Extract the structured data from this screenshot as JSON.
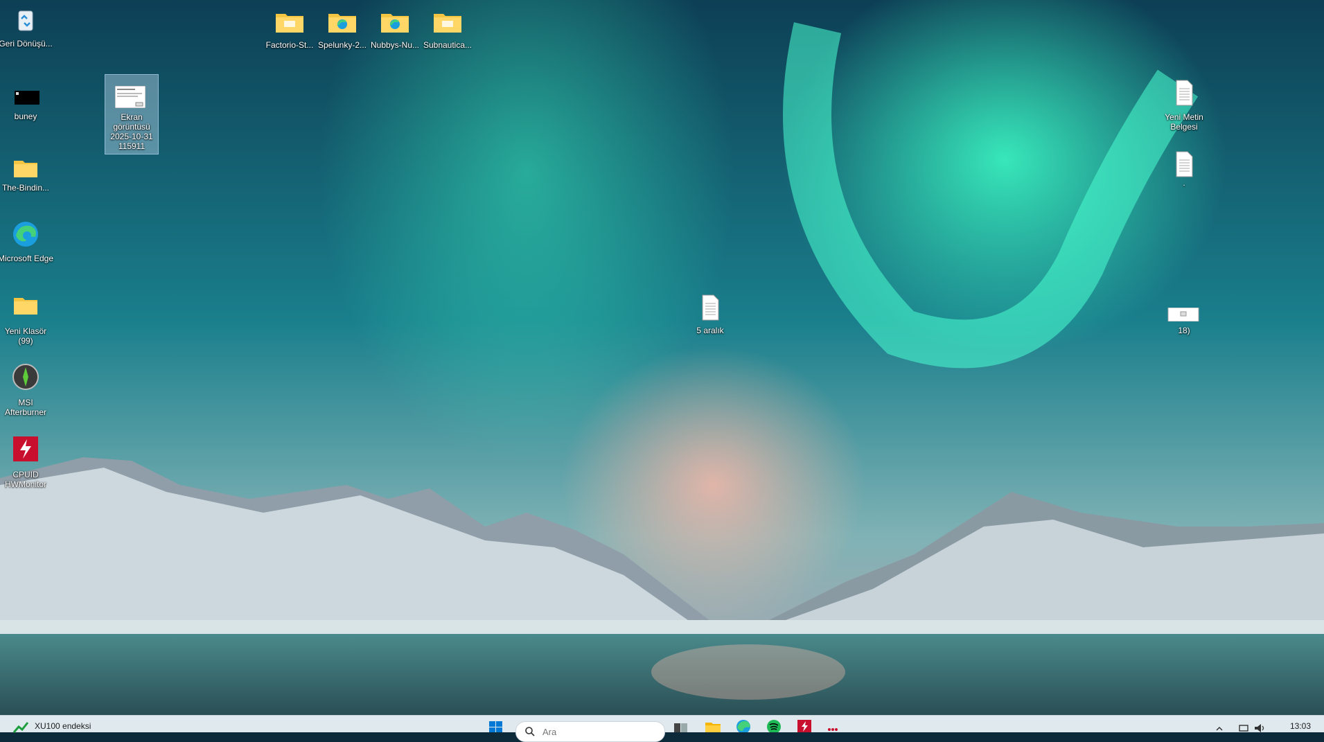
{
  "desktop": {
    "left_column": [
      {
        "label": "Geri Dönüşü...",
        "icon": "recycle-bin-icon"
      },
      {
        "label": "buney",
        "icon": "shortcut-black-icon"
      },
      {
        "label": "The-Bindin...",
        "icon": "folder-icon"
      },
      {
        "label": "Microsoft Edge",
        "icon": "edge-icon"
      },
      {
        "label": "Yeni Klasör (99)",
        "icon": "folder-icon"
      },
      {
        "label": "MSI Afterburner",
        "icon": "msi-afterburner-icon"
      },
      {
        "label": "CPUID HWMonitor",
        "icon": "hwmonitor-icon"
      }
    ],
    "top_row": [
      {
        "label": "Factorio-St...",
        "icon": "folder-icon"
      },
      {
        "label": "Spelunky-2...",
        "icon": "folder-edge-icon"
      },
      {
        "label": "Nubbys-Nu...",
        "icon": "folder-edge-icon"
      },
      {
        "label": "Subnautica...",
        "icon": "folder-icon"
      }
    ],
    "screenshot_file": {
      "label": "Ekran görüntüsü 2025-10-31 115911",
      "icon": "image-file-icon"
    },
    "text_doc_center": {
      "label": "5 aralık",
      "icon": "text-document-icon"
    },
    "right_column": [
      {
        "label": "Yeni Metin Belgesi",
        "icon": "text-document-icon"
      },
      {
        "label": ".",
        "icon": "text-document-icon"
      },
      {
        "label": "18)",
        "icon": "image-file-icon"
      }
    ]
  },
  "taskbar": {
    "widget_text": "XU100 endeksi",
    "search_placeholder": "Ara",
    "clock_time": "13:03",
    "pinned": [
      "task-view-icon",
      "file-explorer-icon",
      "edge-icon",
      "spotify-icon",
      "hwmonitor-icon",
      "more-icon"
    ],
    "colors": {
      "accent": "#0078d4",
      "taskbar_bg": "#dfe9ee"
    }
  }
}
